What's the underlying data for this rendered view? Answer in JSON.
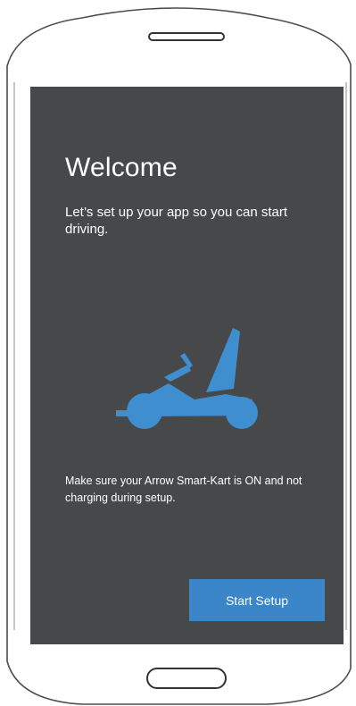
{
  "welcome": {
    "title": "Welcome",
    "subtitle": "Let’s set up your app so you can start driving.",
    "note": "Make sure your Arrow Smart-Kart is ON and not charging during setup.",
    "start_button_label": "Start Setup"
  },
  "icons": {
    "hero": "go-kart-icon"
  },
  "colors": {
    "screen_background": "#474849",
    "accent": "#3a86c8",
    "text": "#ffffff"
  }
}
